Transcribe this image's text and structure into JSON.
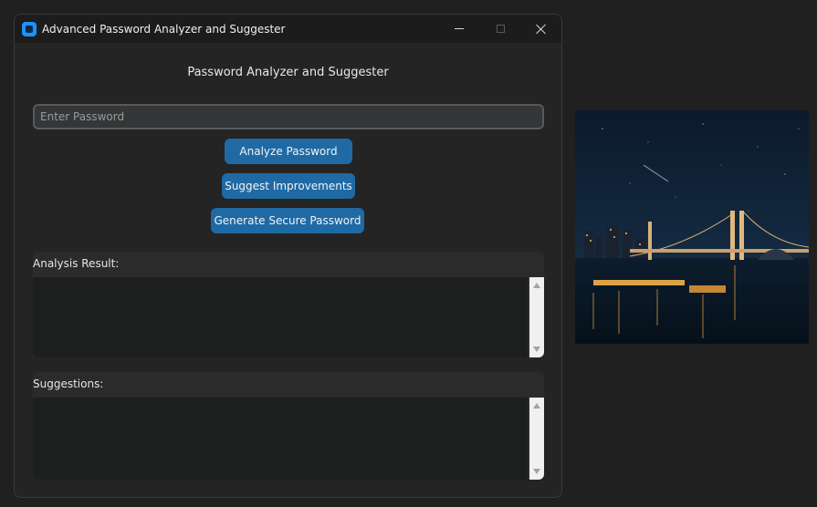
{
  "window": {
    "title": "Advanced Password Analyzer and Suggester",
    "controls": [
      "minimize",
      "maximize",
      "close"
    ]
  },
  "main": {
    "heading": "Password Analyzer and Suggester",
    "password_input": {
      "placeholder": "Enter Password",
      "value": ""
    },
    "buttons": {
      "analyze": "Analyze Password",
      "suggest": "Suggest Improvements",
      "generate": "Generate Secure Password"
    },
    "analysis": {
      "label": "Analysis Result:",
      "content": ""
    },
    "suggestions": {
      "label": "Suggestions:",
      "content": ""
    }
  },
  "background_image": {
    "description": "night-city-bridge-photo"
  },
  "colors": {
    "accent": "#1f6aa5",
    "window_bg": "#242424",
    "titlebar_bg": "#1c1c1c",
    "input_bg": "#343638",
    "textbox_bg": "#1d1e1e",
    "desktop_bg": "#202020"
  }
}
